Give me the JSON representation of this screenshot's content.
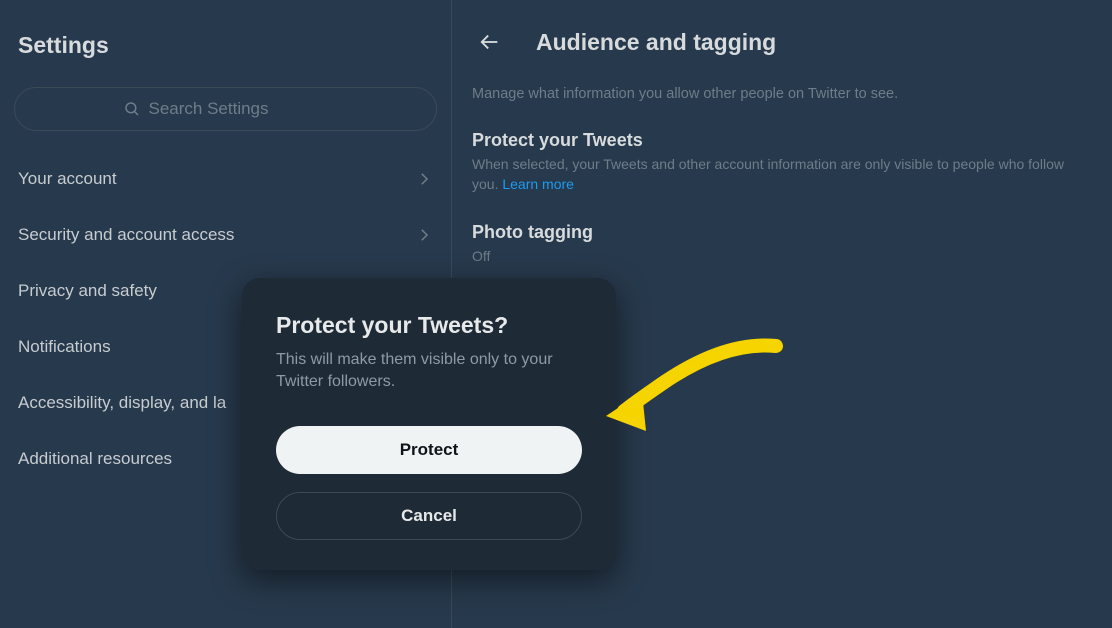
{
  "sidebar": {
    "title": "Settings",
    "search_placeholder": "Search Settings",
    "items": [
      {
        "label": "Your account"
      },
      {
        "label": "Security and account access"
      },
      {
        "label": "Privacy and safety"
      },
      {
        "label": "Notifications"
      },
      {
        "label": "Accessibility, display, and la"
      },
      {
        "label": "Additional resources"
      }
    ]
  },
  "main": {
    "title": "Audience and tagging",
    "description": "Manage what information you allow other people on Twitter to see.",
    "protect": {
      "title": "Protect your Tweets",
      "desc": "When selected, your Tweets and other account information are only visible to people who follow you.",
      "learn_more": "Learn more"
    },
    "photo_tagging": {
      "title": "Photo tagging",
      "value": "Off"
    }
  },
  "modal": {
    "title": "Protect your Tweets?",
    "desc": "This will make them visible only to your Twitter followers.",
    "confirm_label": "Protect",
    "cancel_label": "Cancel"
  }
}
